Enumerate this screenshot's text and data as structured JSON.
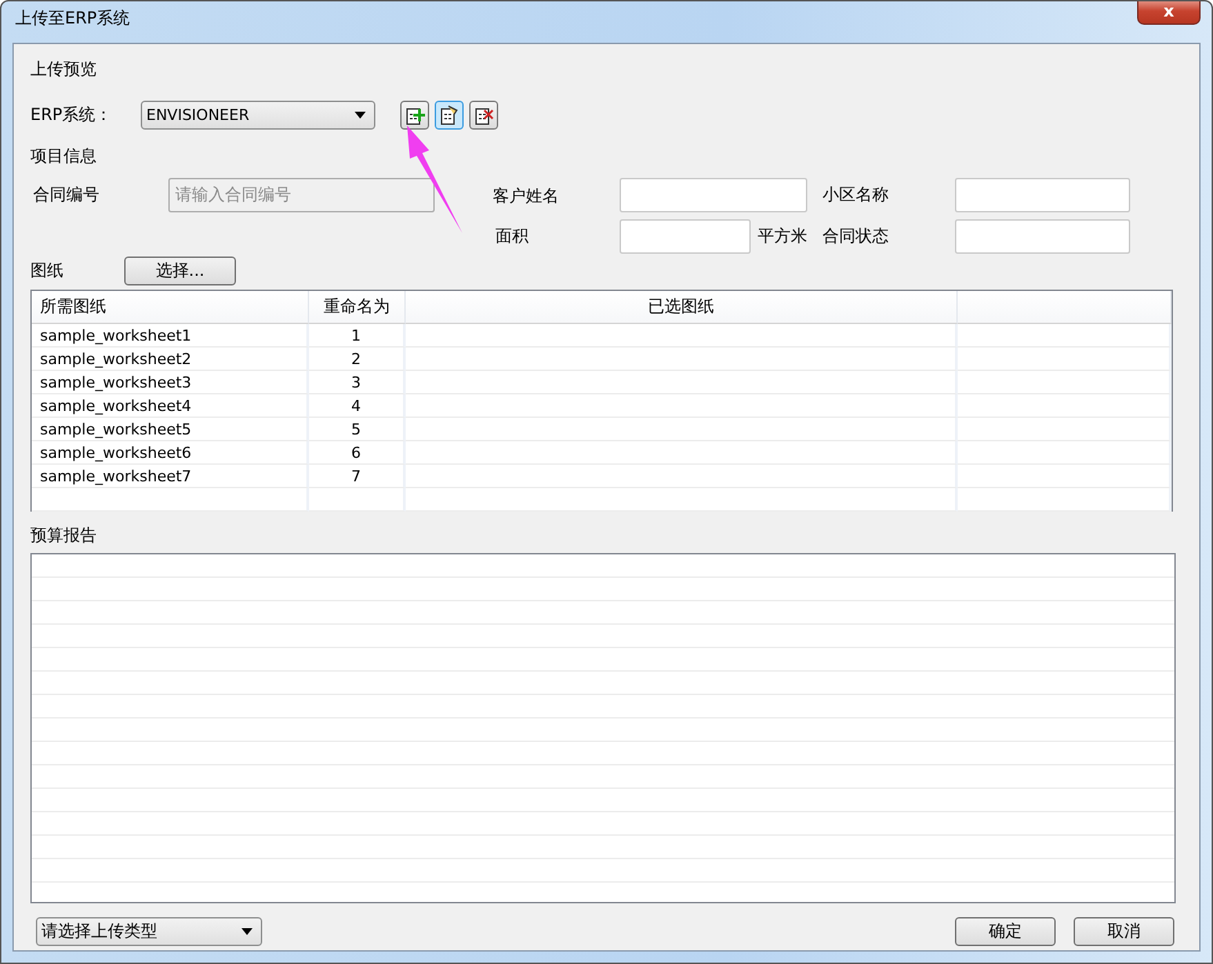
{
  "window": {
    "title": "上传至ERP系统",
    "close": "x"
  },
  "preview_heading": "上传预览",
  "erp": {
    "label": "ERP系统：",
    "value": "ENVISIONEER"
  },
  "erp_buttons": [
    {
      "kind": "add",
      "highlighted": false
    },
    {
      "kind": "paste",
      "highlighted": true
    },
    {
      "kind": "delete",
      "highlighted": false
    }
  ],
  "project_heading": "项目信息",
  "contract_number": {
    "label": "合同编号",
    "placeholder": "请输入合同编号"
  },
  "customer_name": {
    "label": "客户姓名"
  },
  "community_name": {
    "label": "小区名称"
  },
  "area": {
    "label": "面积",
    "unit": "平方米"
  },
  "contract_status": {
    "label": "合同状态"
  },
  "drawings": {
    "label": "图纸",
    "button": "选择..."
  },
  "table": {
    "columns": [
      "所需图纸",
      "重命名为",
      "已选图纸"
    ],
    "rows": [
      [
        "sample_worksheet1",
        "1"
      ],
      [
        "sample_worksheet2",
        "2"
      ],
      [
        "sample_worksheet3",
        "3"
      ],
      [
        "sample_worksheet4",
        "4"
      ],
      [
        "sample_worksheet5",
        "5"
      ],
      [
        "sample_worksheet6",
        "6"
      ],
      [
        "sample_worksheet7",
        "7"
      ]
    ]
  },
  "report_heading": "预算报告",
  "upload_type": {
    "value": "请选择上传类型"
  },
  "buttons": [
    "确定",
    "取消"
  ]
}
